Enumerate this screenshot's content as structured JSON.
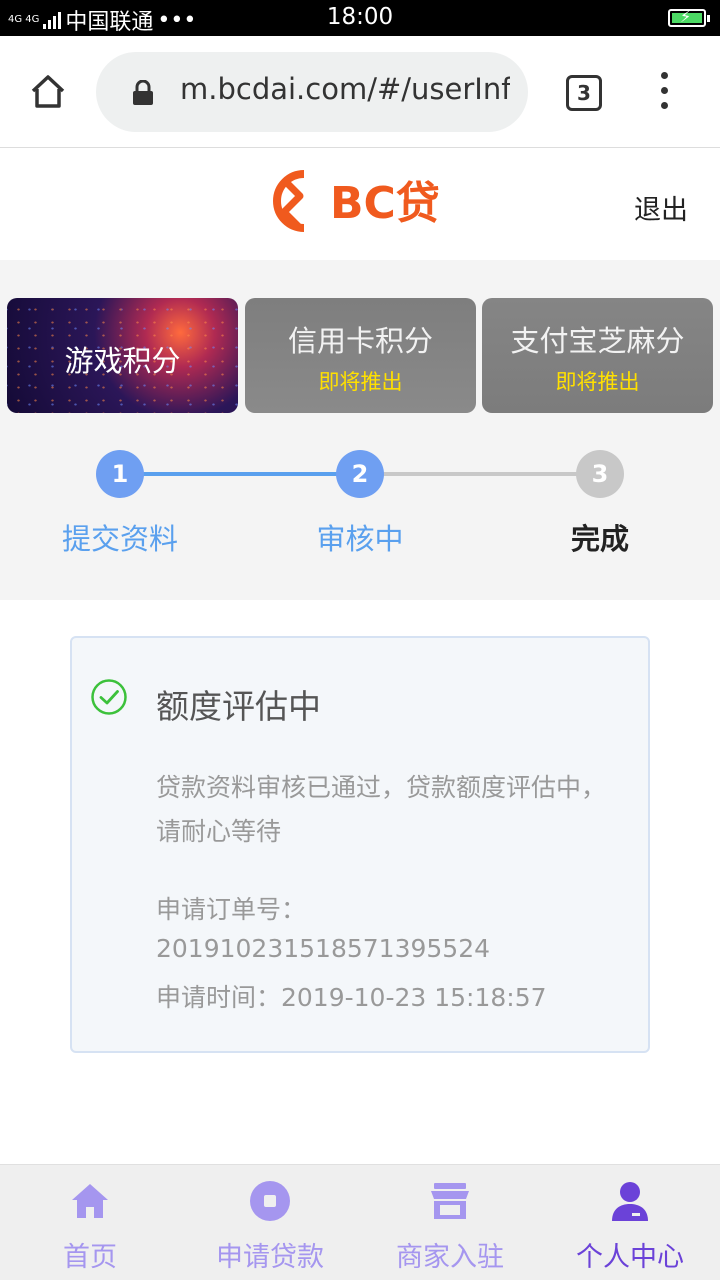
{
  "status_bar": {
    "network": "4G 4G",
    "carrier": "中国联通",
    "dots": "•••",
    "time": "18:00"
  },
  "browser": {
    "url": "m.bcdai.com/#/userInfo",
    "tab_count": "3"
  },
  "header": {
    "logo_text": "BC贷",
    "logout_label": "退出"
  },
  "cards": [
    {
      "title": "游戏积分",
      "subtitle": ""
    },
    {
      "title": "信用卡积分",
      "subtitle": "即将推出"
    },
    {
      "title": "支付宝芝麻分",
      "subtitle": "即将推出"
    }
  ],
  "steps": [
    {
      "number": "1",
      "label": "提交资料"
    },
    {
      "number": "2",
      "label": "审核中"
    },
    {
      "number": "3",
      "label": "完成"
    }
  ],
  "status_panel": {
    "title": "额度评估中",
    "description": "贷款资料审核已通过，贷款额度评估中，请耐心等待",
    "order_label": "申请订单号：",
    "order_number": "201910231518571395524",
    "apply_time": "申请时间：2019-10-23 15:18:57"
  },
  "bottom_nav": [
    {
      "label": "首页",
      "icon": "home-icon"
    },
    {
      "label": "申请贷款",
      "icon": "apply-loan-icon"
    },
    {
      "label": "商家入驻",
      "icon": "store-icon"
    },
    {
      "label": "个人中心",
      "icon": "user-icon",
      "active": true
    }
  ],
  "colors": {
    "accent_blue": "#5aa0ee",
    "nav_inactive": "#a596ef",
    "nav_active": "#6b42d8",
    "logo_orange": "#f05a1e",
    "badge_yellow": "#ffe000"
  }
}
